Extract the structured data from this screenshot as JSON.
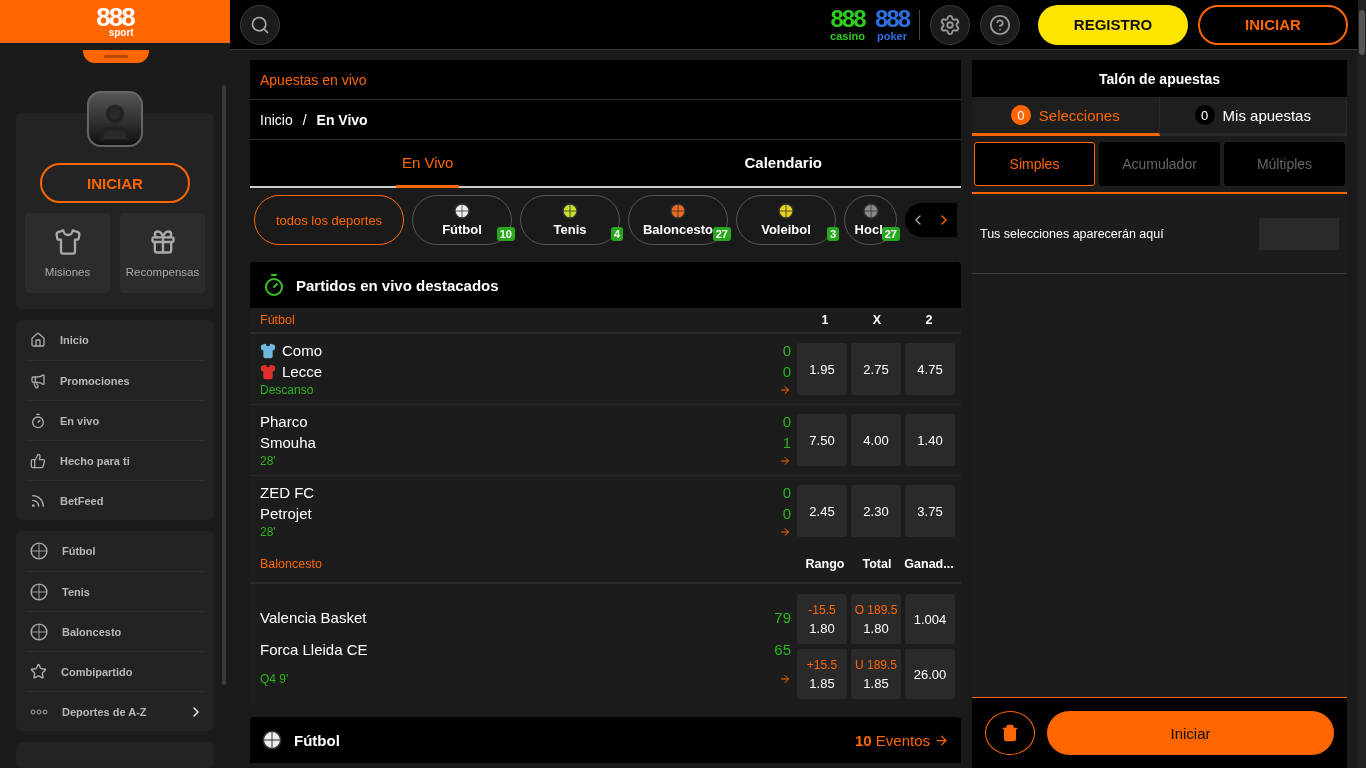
{
  "logo": {
    "main": "888",
    "sub": "sport"
  },
  "header": {
    "brands": [
      {
        "main": "888",
        "sub": "casino",
        "color": "#2ecc1f"
      },
      {
        "main": "888",
        "sub": "poker",
        "color": "#2e6fe0"
      }
    ],
    "register": "REGISTRO",
    "login": "INICIAR"
  },
  "sidebar": {
    "login": "INICIAR",
    "tiles": [
      "Misiones",
      "Recompensas"
    ],
    "groups": [
      [
        "Inicio",
        "Promociones",
        "En vivo",
        "Hecho para ti",
        "BetFeed"
      ],
      [
        "Fútbol",
        "Tenis",
        "Baloncesto",
        "Combipartido",
        "Deportes de A-Z"
      ]
    ]
  },
  "main": {
    "title": "Apuestas en vivo",
    "breadcrumb": [
      "Inicio",
      "/",
      "En Vivo"
    ],
    "tabs": [
      {
        "label": "En Vivo",
        "selected": true
      },
      {
        "label": "Calendario",
        "selected": false
      }
    ],
    "sports": [
      {
        "label": "todos los deportes",
        "selected": true
      },
      {
        "label": "Fútbol",
        "count": "10",
        "selected": false
      },
      {
        "label": "Tenis",
        "count": "4",
        "selected": false
      },
      {
        "label": "Baloncesto",
        "count": "27",
        "selected": false
      },
      {
        "label": "Voleibol",
        "count": "3",
        "selected": false
      },
      {
        "label": "Hock",
        "count": "27",
        "selected": false
      }
    ],
    "featured": {
      "title": "Partidos en vivo destacados",
      "sections": [
        {
          "sport": "Fútbol",
          "columns": [
            "1",
            "X",
            "2"
          ],
          "events": [
            {
              "teams": [
                {
                  "name": "Como",
                  "score": "0",
                  "color": "#6fb7e0"
                },
                {
                  "name": "Lecce",
                  "score": "0",
                  "color": "#e0302a"
                }
              ],
              "status": "Descanso",
              "odds": [
                [
                  {
                    "price": "1.95"
                  },
                  {
                    "price": "2.75"
                  },
                  {
                    "price": "4.75"
                  }
                ]
              ]
            },
            {
              "teams": [
                {
                  "name": "Pharco",
                  "score": "0"
                },
                {
                  "name": "Smouha",
                  "score": "1"
                }
              ],
              "status": "28'",
              "odds": [
                [
                  {
                    "price": "7.50"
                  },
                  {
                    "price": "4.00"
                  },
                  {
                    "price": "1.40"
                  }
                ]
              ]
            },
            {
              "teams": [
                {
                  "name": "ZED FC",
                  "score": "0"
                },
                {
                  "name": "Petrojet",
                  "score": "0"
                }
              ],
              "status": "28'",
              "odds": [
                [
                  {
                    "price": "2.45"
                  },
                  {
                    "price": "2.30"
                  },
                  {
                    "price": "3.75"
                  }
                ]
              ]
            }
          ]
        },
        {
          "sport": "Baloncesto",
          "columns": [
            "Rango",
            "Total",
            "Ganad..."
          ],
          "events": [
            {
              "teams": [
                {
                  "name": "Valencia Basket",
                  "score": "79"
                },
                {
                  "name": "Forca Lleida CE",
                  "score": "65"
                }
              ],
              "status": "Q4 9'",
              "odds": [
                [
                  {
                    "line": "-15.5",
                    "price": "1.80"
                  },
                  {
                    "line": "O 189.5",
                    "price": "1.80"
                  },
                  {
                    "price": "1.004"
                  }
                ],
                [
                  {
                    "line": "+15.5",
                    "price": "1.85"
                  },
                  {
                    "line": "U 189.5",
                    "price": "1.85"
                  },
                  {
                    "price": "26.00"
                  }
                ]
              ]
            }
          ]
        }
      ]
    },
    "next": {
      "title": "Fútbol",
      "link": "**10** Eventos"
    }
  },
  "betslip": {
    "title": "Talón de apuestas",
    "tabs": [
      {
        "count": "0",
        "label": "Selecciones",
        "selected": true
      },
      {
        "count": "0",
        "label": "Mis apuestas",
        "selected": false
      }
    ],
    "types": [
      {
        "label": "Simples",
        "selected": true
      },
      {
        "label": "Acumulador",
        "selected": false
      },
      {
        "label": "Múltiples",
        "selected": false
      }
    ],
    "empty": "Tus selecciones aparecerán aquí",
    "submit": "Iniciar"
  }
}
